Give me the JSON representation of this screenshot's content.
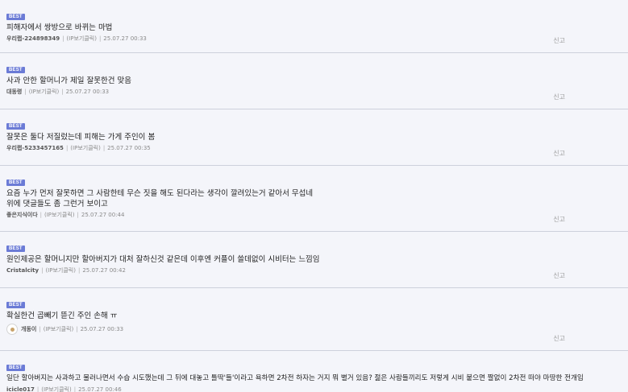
{
  "badge_label": "BEST",
  "report_label": "신고",
  "ip_label": "(IP보기클릭)",
  "comments": [
    {
      "text": "피해자에서 쌍방으로 바뀌는 마법",
      "author": "우리랩-224898349",
      "date": "25.07.27 00:33"
    },
    {
      "text": "사과 안한 할머니가 제일 잘못한건 맞음",
      "author": "대동령",
      "date": "25.07.27 00:33"
    },
    {
      "text": "잘못은 둘다 저질렀는데 피해는 가게 주인이 봄",
      "author": "우리랩-5233457165",
      "date": "25.07.27 00:35"
    },
    {
      "text": "요즘 누가 먼저 잘못하면 그 사람한테 무슨 짓을 해도 된다라는 생각이 깔려있는거 같아서 무섭네\n위에 댓글들도 좀 그런거 보이고",
      "author": "좋은지식이다",
      "date": "25.07.27 00:44"
    },
    {
      "text": "원인제공은 할머니지만 할아버지가 대처 잘하신것 같은데 이후엔 커플이 쓸데없이 시비터는 느낌임",
      "author": "Cristalcity",
      "date": "25.07.27 00:42"
    },
    {
      "text": "확실한건 곱빼기 뜯긴 주인 손해 ㅠ",
      "author": "개동이",
      "date": "25.07.27 00:33"
    },
    {
      "text": "일단 할아버지는 사과하고 물러나면서 수습 시도했는데 그 뒤에 대놓고 틀딱'들'이라고 욕하면 2차전 하자는 거지 뭐 별거 있음? 젊은 사람들끼리도 저렇게 시비 붙으면 짤없이 2차전 떠야 마땅한 전개임",
      "author": "icicle017",
      "date": "25.07.27 00:46"
    }
  ]
}
